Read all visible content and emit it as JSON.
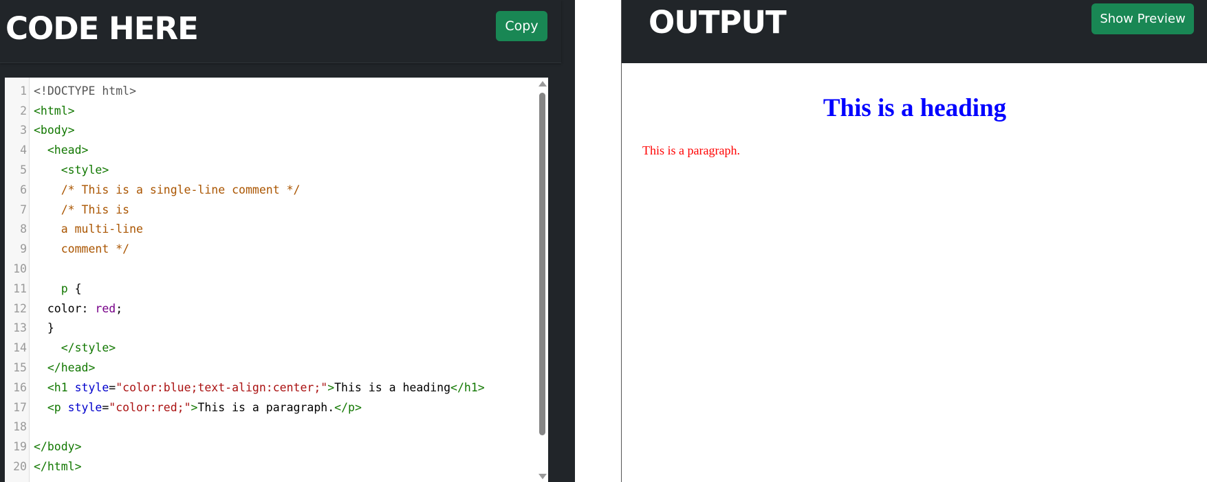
{
  "code_panel": {
    "title": "CODE HERE",
    "copy_label": "Copy",
    "lines": [
      {
        "num": "1",
        "tokens": [
          {
            "t": "<!DOCTYPE html>",
            "c": "meta"
          }
        ]
      },
      {
        "num": "2",
        "tokens": [
          {
            "t": "<html>",
            "c": "tag"
          }
        ]
      },
      {
        "num": "3",
        "tokens": [
          {
            "t": "<body>",
            "c": "tag"
          }
        ]
      },
      {
        "num": "4",
        "tokens": [
          {
            "t": "  ",
            "c": "plain"
          },
          {
            "t": "<head>",
            "c": "tag"
          }
        ]
      },
      {
        "num": "5",
        "tokens": [
          {
            "t": "    ",
            "c": "plain"
          },
          {
            "t": "<style>",
            "c": "tag"
          }
        ]
      },
      {
        "num": "6",
        "tokens": [
          {
            "t": "    ",
            "c": "plain"
          },
          {
            "t": "/* This is a single-line comment */",
            "c": "comment"
          }
        ]
      },
      {
        "num": "7",
        "tokens": [
          {
            "t": "    ",
            "c": "plain"
          },
          {
            "t": "/* This is",
            "c": "comment"
          }
        ]
      },
      {
        "num": "8",
        "tokens": [
          {
            "t": "    ",
            "c": "plain"
          },
          {
            "t": "a multi-line",
            "c": "comment"
          }
        ]
      },
      {
        "num": "9",
        "tokens": [
          {
            "t": "    ",
            "c": "plain"
          },
          {
            "t": "comment */",
            "c": "comment"
          }
        ]
      },
      {
        "num": "10",
        "tokens": []
      },
      {
        "num": "11",
        "tokens": [
          {
            "t": "    ",
            "c": "plain"
          },
          {
            "t": "p",
            "c": "tag"
          },
          {
            "t": " {",
            "c": "plain"
          }
        ]
      },
      {
        "num": "12",
        "tokens": [
          {
            "t": "  color: ",
            "c": "plain"
          },
          {
            "t": "red",
            "c": "atom"
          },
          {
            "t": ";",
            "c": "plain"
          }
        ]
      },
      {
        "num": "13",
        "tokens": [
          {
            "t": "  }",
            "c": "plain"
          }
        ]
      },
      {
        "num": "14",
        "tokens": [
          {
            "t": "    ",
            "c": "plain"
          },
          {
            "t": "</style>",
            "c": "tag"
          }
        ]
      },
      {
        "num": "15",
        "tokens": [
          {
            "t": "  ",
            "c": "plain"
          },
          {
            "t": "</head>",
            "c": "tag"
          }
        ]
      },
      {
        "num": "16",
        "tokens": [
          {
            "t": "  ",
            "c": "plain"
          },
          {
            "t": "<h1",
            "c": "tag"
          },
          {
            "t": " style",
            "c": "attr"
          },
          {
            "t": "=",
            "c": "plain"
          },
          {
            "t": "\"color:blue;text-align:center;\"",
            "c": "string"
          },
          {
            "t": ">",
            "c": "tag"
          },
          {
            "t": "This is a heading",
            "c": "plain"
          },
          {
            "t": "</h1>",
            "c": "tag"
          }
        ]
      },
      {
        "num": "17",
        "tokens": [
          {
            "t": "  ",
            "c": "plain"
          },
          {
            "t": "<p",
            "c": "tag"
          },
          {
            "t": " style",
            "c": "attr"
          },
          {
            "t": "=",
            "c": "plain"
          },
          {
            "t": "\"color:red;\"",
            "c": "string"
          },
          {
            "t": ">",
            "c": "tag"
          },
          {
            "t": "This is a paragraph.",
            "c": "plain"
          },
          {
            "t": "</p>",
            "c": "tag"
          }
        ]
      },
      {
        "num": "18",
        "tokens": []
      },
      {
        "num": "19",
        "tokens": [
          {
            "t": "</body>",
            "c": "tag"
          }
        ]
      },
      {
        "num": "20",
        "tokens": [
          {
            "t": "</html>",
            "c": "tag"
          }
        ]
      }
    ]
  },
  "output_panel": {
    "title": "OUTPUT",
    "preview_label": "Show Preview",
    "heading_text": "This is a heading",
    "heading_color": "#0000ff",
    "paragraph_text": "This is a paragraph.",
    "paragraph_color": "#ff0000"
  },
  "colors": {
    "dark_bg": "#212529",
    "button_green": "#198754"
  },
  "icons": [
    "scroll-up-arrow-icon",
    "scroll-down-arrow-icon"
  ]
}
